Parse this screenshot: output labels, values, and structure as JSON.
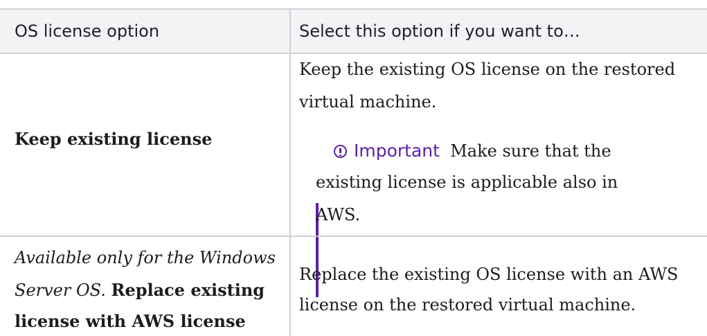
{
  "table": {
    "headers": {
      "option": "OS license option",
      "select_if": "Select this option if you want to…"
    },
    "rows": [
      {
        "option_bold": "Keep existing license",
        "description_line1": "Keep the existing OS license on the restored",
        "description_line2": "virtual machine.",
        "callout": {
          "label": "Important",
          "line1": "Make sure that the",
          "line2": "existing license is applicable also in",
          "line3": "AWS."
        }
      },
      {
        "option_italic_line1": "Available only for the Windows",
        "option_italic_line2": "Server OS.",
        "option_bold_line2": "Replace existing",
        "option_bold_line3": "license with AWS license",
        "description_line1": "Replace the existing OS license with an AWS",
        "description_line2": "license on the restored virtual machine."
      }
    ]
  },
  "colors": {
    "accent": "#5b1fa8",
    "header_bg": "#f3f3f5",
    "border": "#cfcfd6"
  }
}
